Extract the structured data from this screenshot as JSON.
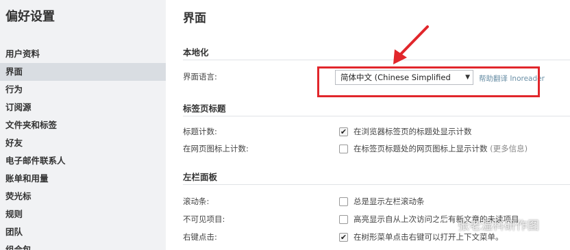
{
  "sidebar": {
    "title": "偏好设置",
    "items": [
      {
        "label": "用户资料",
        "active": false
      },
      {
        "label": "界面",
        "active": true
      },
      {
        "label": "行为",
        "active": false
      },
      {
        "label": "订阅源",
        "active": false
      },
      {
        "label": "文件夹和标签",
        "active": false
      },
      {
        "label": "好友",
        "active": false
      },
      {
        "label": "电子邮件联系人",
        "active": false
      },
      {
        "label": "账单和用量",
        "active": false
      },
      {
        "label": "荧光标",
        "active": false
      },
      {
        "label": "规则",
        "active": false
      },
      {
        "label": "团队",
        "active": false
      },
      {
        "label": "组合包",
        "active": false
      }
    ]
  },
  "main": {
    "title": "界面",
    "localization": {
      "section_title": "本地化",
      "language_label": "界面语言:",
      "language_value": "简体中文 (Chinese Simplified",
      "help_link": "帮助翻译 Inoreader"
    },
    "tab_title": {
      "section_title": "标签页标题",
      "rows": [
        {
          "label": "标题计数:",
          "text": "在浏览器标签页的标题处显示计数",
          "checked": true
        },
        {
          "label": "在网页图标上计数:",
          "text": "在标签页标题处的网页图标上显示计数",
          "extra": "(更多信息)",
          "checked": false
        }
      ]
    },
    "left_panel": {
      "section_title": "左栏面板",
      "rows": [
        {
          "label": "滚动条:",
          "text": "总是显示左栏滚动条",
          "checked": false
        },
        {
          "label": "不可见项目:",
          "text": "高亮显示自从上次访问之后有新文章的未读项目",
          "checked": false
        },
        {
          "label": "右键点击:",
          "text": "在树形菜单点击右键可以打开上下文菜单。",
          "checked": true
        }
      ]
    }
  },
  "watermark": {
    "text": "张老湿科研作图"
  },
  "colors": {
    "sidebar_bg": "#f1f2f4",
    "active_bg": "#d9dde2",
    "annotation_red": "#e1262b",
    "link": "#6a8fa6"
  },
  "icons": {
    "dropdown": "triangle-down",
    "check": "checkmark",
    "watermark": "wechat-icon"
  }
}
